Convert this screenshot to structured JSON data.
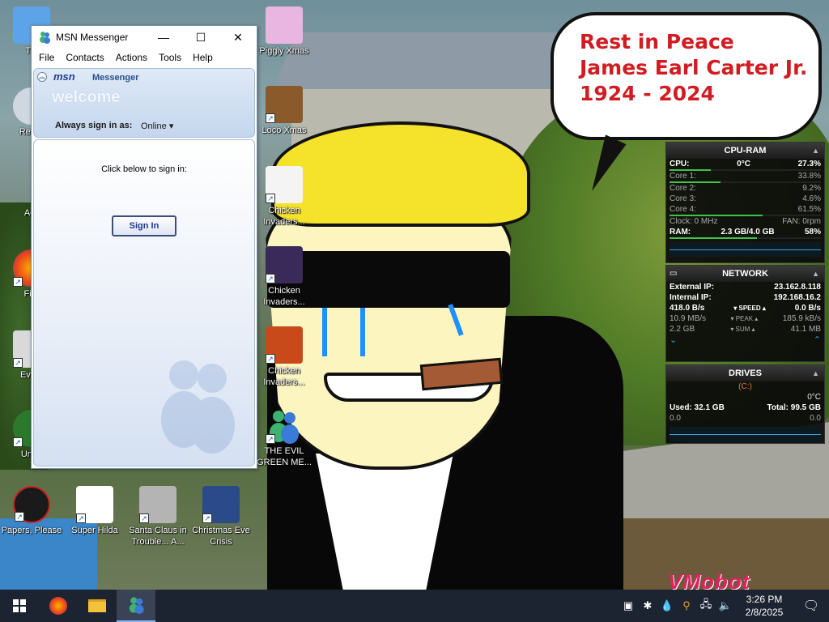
{
  "bubble": {
    "line1": "Rest in Peace",
    "line2": "James Earl Carter Jr.",
    "line3": "1924 - 2024"
  },
  "watermark": "VMobot",
  "desktop_icons": {
    "this_pc": "Thi",
    "recycle": "Recyc",
    "acti": "Acti",
    "fire": "Fire",
    "every": "Every",
    "unde": "Unde",
    "piggly": "Piggly Xmas",
    "loco": "Loco Xmas",
    "chicken1": "Chicken Invaders...",
    "chicken2": "Chicken Invaders...",
    "chicken3": "Chicken Invaders...",
    "evil": "THE EVIL GREEN ME...",
    "papers": "Papers, Please",
    "hilda": "Super Hilda",
    "santa": "Santa Claus in Trouble... A...",
    "xmas_eve": "Christmas Eve Crisis"
  },
  "msn": {
    "title": "MSN Messenger",
    "menu": [
      "File",
      "Contacts",
      "Actions",
      "Tools",
      "Help"
    ],
    "brand": "msn",
    "brand_suffix": "Messenger",
    "welcome": "welcome",
    "always_label": "Always sign in as:",
    "status": "Online ▾",
    "prompt": "Click below to sign in:",
    "sign_in": "Sign In"
  },
  "cpu": {
    "title": "CPU-RAM",
    "cpu_label": "CPU:",
    "temp": "0°C",
    "cpu_pct": "27.3%",
    "cpu_pct_value": 27.3,
    "cores": [
      {
        "label": "Core 1:",
        "value": "33.8%",
        "pct": 33.8
      },
      {
        "label": "Core 2:",
        "value": "9.2%",
        "pct": 9.2
      },
      {
        "label": "Core 3:",
        "value": "4.6%",
        "pct": 4.6
      },
      {
        "label": "Core 4:",
        "value": "61.5%",
        "pct": 61.5
      }
    ],
    "clock": "Clock: 0 MHz",
    "fan": "FAN: 0rpm",
    "ram_label": "RAM:",
    "ram": "2.3 GB/4.0 GB",
    "ram_pct": "58%",
    "ram_pct_value": 58
  },
  "network": {
    "title": "NETWORK",
    "ext_label": "External IP:",
    "ext_ip": "23.162.8.118",
    "int_label": "Internal IP:",
    "int_ip": "192.168.16.2",
    "speed_left": "418.0 B/s",
    "speed_label": "▾ SPEED ▴",
    "speed_right": "0.0 B/s",
    "peak_left": "10.9 MB/s",
    "peak_label": "▾ PEAK ▴",
    "peak_right": "185.9 kB/s",
    "sum_left": "2.2 GB",
    "sum_label": "▾ SUM ▴",
    "sum_right": "41.1 MB"
  },
  "drives": {
    "title": "DRIVES",
    "drive": "(C:)",
    "temp": "0°C",
    "used": "Used: 32.1 GB",
    "total": "Total: 99.5 GB",
    "read": "0.0",
    "write": "0.0"
  },
  "taskbar": {
    "time": "3:26 PM",
    "date": "2/8/2025"
  }
}
